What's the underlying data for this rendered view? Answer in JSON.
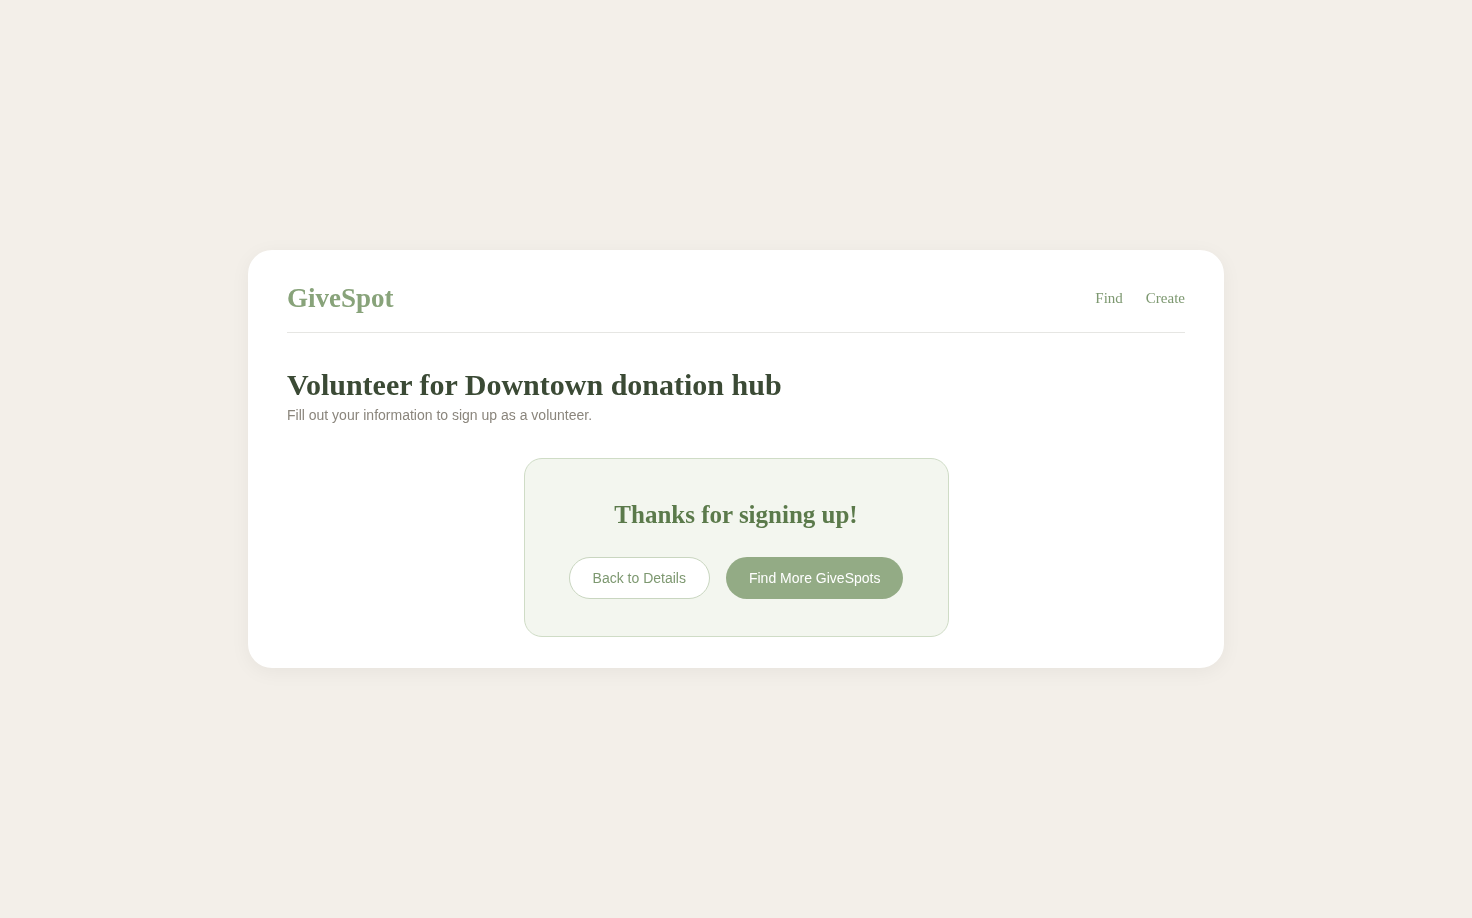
{
  "header": {
    "logo": "GiveSpot",
    "nav": [
      {
        "label": "Find"
      },
      {
        "label": "Create"
      }
    ]
  },
  "page": {
    "title": "Volunteer for Downtown donation hub",
    "subtitle": "Fill out your information to sign up as a volunteer."
  },
  "confirmation": {
    "heading": "Thanks for signing up!",
    "buttons": [
      {
        "label": "Back to Details",
        "kind": "secondary"
      },
      {
        "label": "Find More GiveSpots",
        "kind": "primary"
      }
    ]
  }
}
